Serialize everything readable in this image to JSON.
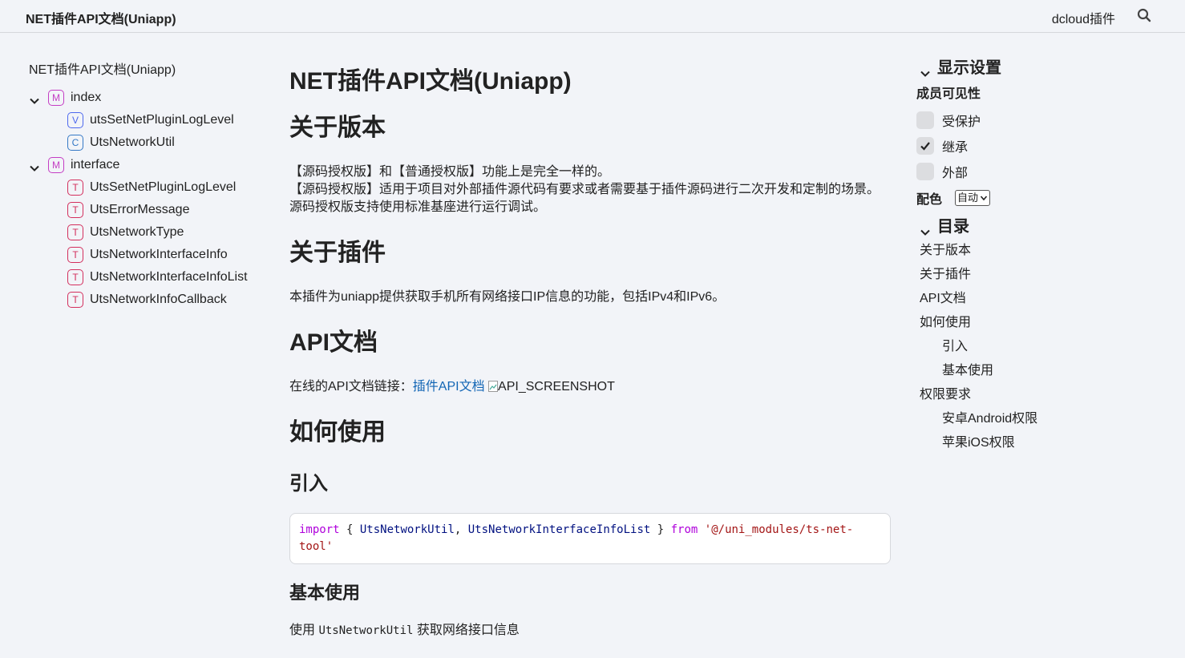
{
  "topbar": {
    "title": "NET插件API文档(Uniapp)",
    "brand_link": "dcloud插件",
    "search_icon": "search-icon"
  },
  "nav": {
    "root": "NET插件API文档(Uniapp)",
    "modules": [
      {
        "kind": "M",
        "label": "index",
        "expanded": true,
        "children": [
          {
            "kind": "V",
            "label": "utsSetNetPluginLogLevel"
          },
          {
            "kind": "C",
            "label": "UtsNetworkUtil"
          }
        ]
      },
      {
        "kind": "M",
        "label": "interface",
        "expanded": true,
        "children": [
          {
            "kind": "T",
            "label": "UtsSetNetPluginLogLevel"
          },
          {
            "kind": "T",
            "label": "UtsErrorMessage"
          },
          {
            "kind": "T",
            "label": "UtsNetworkType"
          },
          {
            "kind": "T",
            "label": "UtsNetworkInterfaceInfo"
          },
          {
            "kind": "T",
            "label": "UtsNetworkInterfaceInfoList"
          },
          {
            "kind": "T",
            "label": "UtsNetworkInfoCallback"
          }
        ]
      }
    ]
  },
  "main": {
    "title": "NET插件API文档(Uniapp)",
    "version_heading": "关于版本",
    "version_lines": [
      "【源码授权版】和【普通授权版】功能上是完全一样的。",
      "【源码授权版】适用于项目对外部插件源代码有要求或者需要基于插件源码进行二次开发和定制的场景。",
      "源码授权版支持使用标准基座进行运行调试。"
    ],
    "plugin_heading": "关于插件",
    "plugin_text": "本插件为uniapp提供获取手机所有网络接口IP信息的功能，包括IPv4和IPv6。",
    "api_heading": "API文档",
    "api_text": "在线的API文档链接：",
    "api_link": "插件API文档",
    "api_image_alt": "API_SCREENSHOT",
    "usage_heading": "如何使用",
    "import_heading": "引入",
    "code": {
      "kw_import": "import",
      "brace_open": " { ",
      "id1": "UtsNetworkUtil",
      "comma": ", ",
      "id2": "UtsNetworkInterfaceInfoList",
      "brace_close": " } ",
      "kw_from": "from",
      "string_part1": "'@/uni_modules/ts-net-",
      "string_part2": "tool'"
    },
    "basic_heading": "基本使用",
    "basic_text_before": "使用 ",
    "basic_text_code": "UtsNetworkUtil",
    "basic_text_after": " 获取网络接口信息"
  },
  "sidebar": {
    "display_heading": "显示设置",
    "visibility_label": "成员可见性",
    "options": [
      {
        "label": "受保护",
        "checked": false
      },
      {
        "label": "继承",
        "checked": true
      },
      {
        "label": "外部",
        "checked": false
      }
    ],
    "theme_label": "配色",
    "theme_value": "自动",
    "toc_heading": "目录",
    "toc": [
      {
        "label": "关于版本",
        "level": 1
      },
      {
        "label": "关于插件",
        "level": 1
      },
      {
        "label": "API文档",
        "level": 1
      },
      {
        "label": "如何使用",
        "level": 1
      },
      {
        "label": "引入",
        "level": 2
      },
      {
        "label": "基本使用",
        "level": 2
      },
      {
        "label": "权限要求",
        "level": 1
      },
      {
        "label": "安卓Android权限",
        "level": 2
      },
      {
        "label": "苹果iOS权限",
        "level": 2
      }
    ]
  }
}
